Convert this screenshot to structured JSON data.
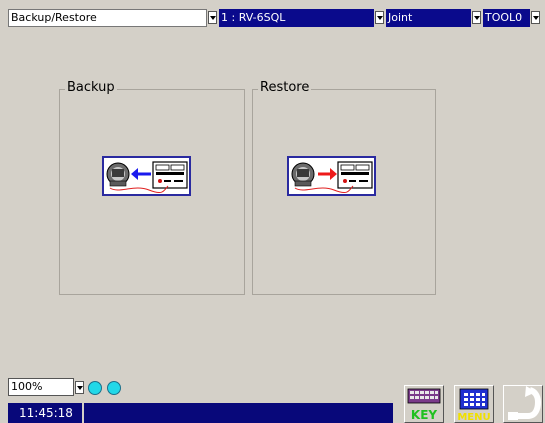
{
  "toolbar": {
    "function_select": "Backup/Restore",
    "robot_select": "1 : RV-6SQL",
    "jog_mode_select": "Joint",
    "tool_select": "TOOL0"
  },
  "groups": {
    "backup": {
      "title": "Backup",
      "icon": "controller-to-pc-backup-icon",
      "arrow_color": "#1a1aee"
    },
    "restore": {
      "title": "Restore",
      "icon": "pc-to-controller-restore-icon",
      "arrow_color": "#ee1a1a"
    }
  },
  "status": {
    "zoom": "100%",
    "time": "11:45:18",
    "lamp_color": "#22d8e8"
  },
  "buttons": {
    "key": {
      "label": "KEY",
      "icon": "keyboard-icon"
    },
    "menu": {
      "label": "MENU",
      "icon": "menu-icon"
    },
    "back": {
      "icon": "return-arrow-icon"
    }
  }
}
